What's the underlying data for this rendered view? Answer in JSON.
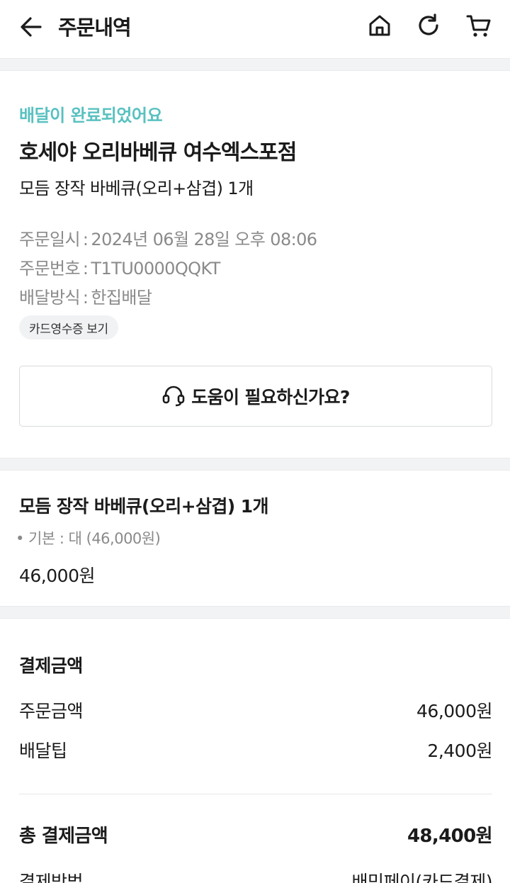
{
  "header": {
    "title": "주문내역",
    "icons": [
      "back-arrow-icon",
      "home-icon",
      "refresh-icon",
      "cart-icon"
    ]
  },
  "order": {
    "status": "배달이 완료되었어요",
    "store_name": "호세야 오리바베큐 여수엑스포점",
    "summary": "모듬 장작 바베큐(오리+삼겹) 1개",
    "info": [
      {
        "label": "주문일시",
        "value": "2024년 06월 28일 오후 08:06"
      },
      {
        "label": "주문번호",
        "value": "T1TU0000QQKT"
      },
      {
        "label": "배달방식",
        "value": "한집배달"
      }
    ],
    "separator": ":",
    "receipt_button": "카드영수증 보기",
    "help_button": "도움이 필요하신가요?"
  },
  "menu_item": {
    "name": "모듬 장작 바베큐(오리+삼겹) 1개",
    "option": "• 기본 : 대 (46,000원)",
    "price": "46,000원"
  },
  "payment": {
    "title": "결제금액",
    "rows": [
      {
        "label": "주문금액",
        "value": "46,000원"
      },
      {
        "label": "배달팁",
        "value": "2,400원"
      }
    ],
    "total_label": "총 결제금액",
    "total_value": "48,400원",
    "method_label": "결제방법",
    "method_value": "배민페이(카드결제)"
  },
  "colors": {
    "status_accent": "#58c1c0",
    "muted_text": "#8a8a8a",
    "section_gap": "#f2f3f5"
  }
}
